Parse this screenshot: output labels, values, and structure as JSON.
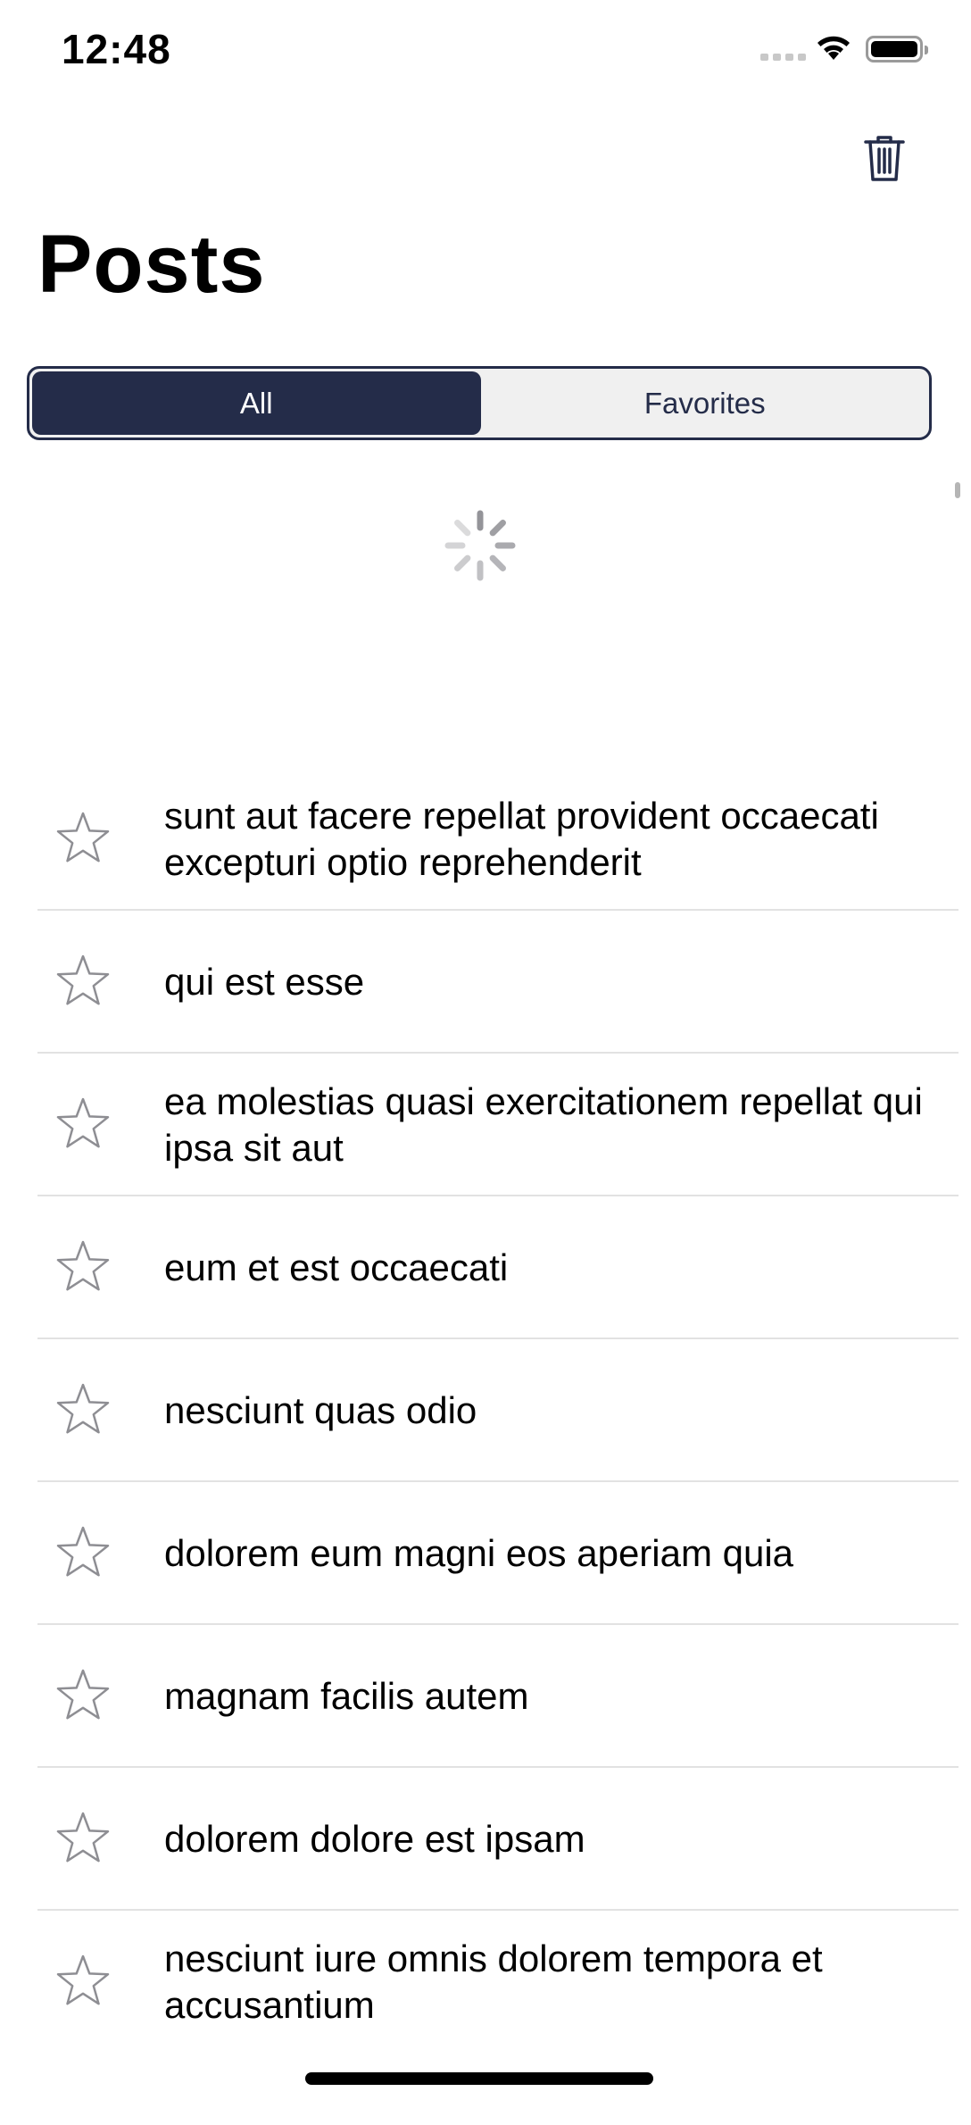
{
  "status_bar": {
    "time": "12:48"
  },
  "nav": {
    "title": "Posts",
    "trash_icon": "trash-icon"
  },
  "segmented_control": {
    "segments": [
      "All",
      "Favorites"
    ],
    "selected": "All"
  },
  "loading": true,
  "posts": [
    {
      "title": "sunt aut facere repellat provident occaecati excepturi optio reprehenderit",
      "favorite": false
    },
    {
      "title": "qui est esse",
      "favorite": false
    },
    {
      "title": "ea molestias quasi exercitationem repellat qui ipsa sit aut",
      "favorite": false
    },
    {
      "title": "eum et est occaecati",
      "favorite": false
    },
    {
      "title": "nesciunt quas odio",
      "favorite": false
    },
    {
      "title": "dolorem eum magni eos aperiam quia",
      "favorite": false
    },
    {
      "title": "magnam facilis autem",
      "favorite": false
    },
    {
      "title": "dolorem dolore est ipsam",
      "favorite": false
    },
    {
      "title": "nesciunt iure omnis dolorem tempora et accusantium",
      "favorite": false
    }
  ],
  "colors": {
    "accent": "#242c49",
    "segment_background": "#f0f0f0",
    "star_outline": "#8e8e93",
    "separator": "#e2e2e2"
  }
}
